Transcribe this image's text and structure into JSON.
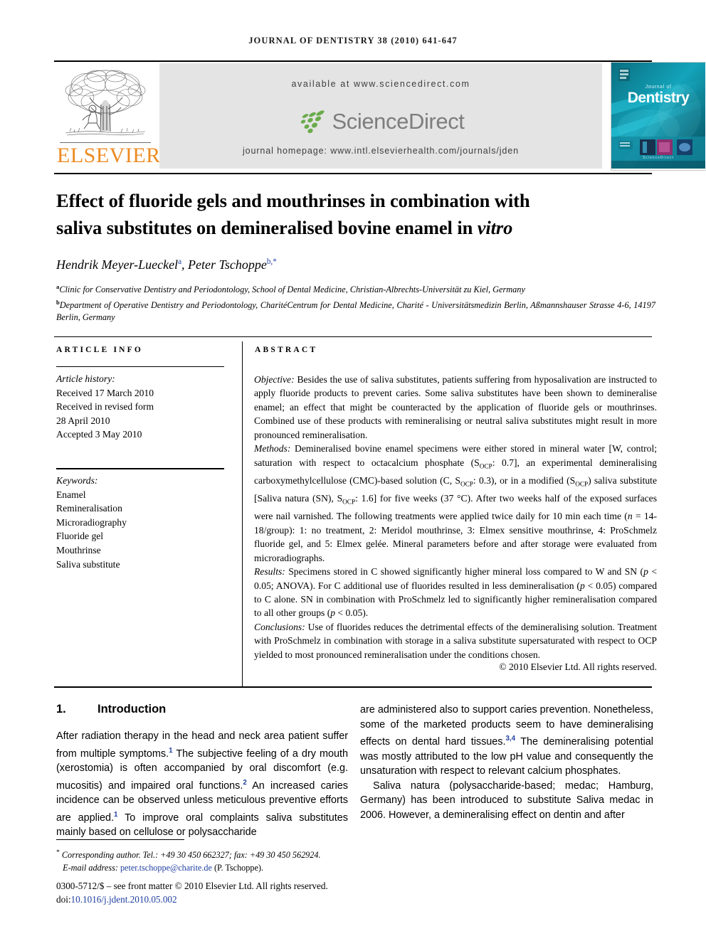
{
  "running_head": "JOURNAL OF DENTISTRY 38 (2010) 641-647",
  "masthead": {
    "publisher_wordmark": "ELSEVIER",
    "available_at": "available at www.sciencedirect.com",
    "sciencedirect_word": "ScienceDirect",
    "journal_homepage": "journal homepage: www.intl.elsevierhealth.com/journals/jden",
    "cover_title_small": "Journal of",
    "cover_title_main": "Dentistry",
    "colors": {
      "elsevier_orange": "#ec8b22",
      "sciencedirect_green": "#6aab4a",
      "sciencedirect_grey": "#7d7d7d",
      "panel_grey": "#e4e4e4",
      "cover_teal": "#0e8a9c"
    }
  },
  "article": {
    "title_line1": "Effect of fluoride gels and mouthrinses in combination with",
    "title_line2_pre": "saliva substitutes on demineralised bovine enamel in ",
    "title_line2_italic": "vitro",
    "authors": [
      {
        "name": "Hendrik Meyer-Lueckel",
        "mark": "a"
      },
      {
        "name": "Peter Tschoppe",
        "mark": "b,*"
      }
    ],
    "affiliations": [
      {
        "mark": "a",
        "text": "Clinic for Conservative Dentistry and Periodontology, School of Dental Medicine, Christian-Albrechts-Universität zu Kiel, Germany"
      },
      {
        "mark": "b",
        "text": "Department of Operative Dentistry and Periodontology, CharitéCentrum for Dental Medicine, Charité - Universitätsmedizin Berlin, Aßmannshauser Strasse 4-6, 14197 Berlin, Germany"
      }
    ]
  },
  "info_column": {
    "heading": "ARTICLE INFO",
    "history_label": "Article history:",
    "history_lines": [
      "Received 17 March 2010",
      "Received in revised form",
      "28 April 2010",
      "Accepted 3 May 2010"
    ],
    "keywords_label": "Keywords:",
    "keywords": [
      "Enamel",
      "Remineralisation",
      "Microradiography",
      "Fluoride gel",
      "Mouthrinse",
      "Saliva substitute"
    ]
  },
  "abstract": {
    "heading": "ABSTRACT",
    "objective_label": "Objective:",
    "objective_text": " Besides the use of saliva substitutes, patients suffering from hyposalivation are instructed to apply fluoride products to prevent caries. Some saliva substitutes have been shown to demineralise enamel; an effect that might be counteracted by the application of fluoride gels or mouthrinses. Combined use of these products with remineralising or neutral saliva substitutes might result in more pronounced remineralisation.",
    "methods_label": "Methods:",
    "methods_text_1": " Demineralised bovine enamel specimens were either stored in mineral water [W, control; saturation with respect to octacalcium phosphate (S",
    "methods_sub_1": "OCP",
    "methods_text_2": ": 0.7], an experimental demineralising carboxymethylcellulose (CMC)-based solution (C, S",
    "methods_sub_2": "OCP",
    "methods_text_3": ": 0.3), or in a modified (S",
    "methods_sub_3": "OCP",
    "methods_text_4": ") saliva substitute [Saliva natura (SN), S",
    "methods_sub_4": "OCP",
    "methods_text_5": ": 1.6] for five weeks (37 °C). After two weeks half of the exposed surfaces were nail varnished. The following treatments were applied twice daily for 10 min each time (",
    "methods_italic_n": "n",
    "methods_text_6": " = 14-18/group): 1: no treatment, 2: Meridol mouthrinse, 3: Elmex sensitive mouthrinse, 4: ProSchmelz fluoride gel, and 5: Elmex gelée. Mineral parameters before and after storage were evaluated from microradiographs.",
    "results_label": "Results:",
    "results_text_1": " Specimens stored in C showed significantly higher mineral loss compared to W and SN (",
    "results_p1": "p",
    "results_text_2": " < 0.05; ANOVA). For C additional use of fluorides resulted in less demineralisation (",
    "results_p2": "p",
    "results_text_3": " < 0.05) compared to C alone. SN in combination with ProSchmelz led to significantly higher remineralisation compared to all other groups (",
    "results_p3": "p",
    "results_text_4": " < 0.05).",
    "conclusions_label": "Conclusions:",
    "conclusions_text": " Use of fluorides reduces the detrimental effects of the demineralising solution. Treatment with ProSchmelz in combination with storage in a saliva substitute supersaturated with respect to OCP yielded to most pronounced remineralisation under the conditions chosen.",
    "copyright": "© 2010 Elsevier Ltd. All rights reserved."
  },
  "introduction": {
    "number": "1.",
    "heading": "Introduction",
    "left_p1_a": "After radiation therapy in the head and neck area patient suffer from multiple symptoms.",
    "left_p1_ref1": "1",
    "left_p1_b": " The subjective feeling of a dry mouth (xerostomia) is often accompanied by oral discomfort (e.g. mucositis) and impaired oral functions.",
    "left_p1_ref2": "2",
    "left_p1_c": " An increased caries incidence can be observed unless meticulous preventive efforts are applied.",
    "left_p1_ref3": "1",
    "left_p1_d": " To improve oral complaints saliva substitutes mainly based on cellulose or polysaccharide",
    "right_p1_a": "are administered also to support caries prevention. Nonetheless, some of the marketed products seem to have demineralising effects on dental hard tissues.",
    "right_p1_ref": "3,4",
    "right_p1_b": " The demineralising potential was mostly attributed to the low pH value and consequently the unsaturation with respect to relevant calcium phosphates.",
    "right_p2": "Saliva natura (polysaccharide-based; medac; Hamburg, Germany) has been introduced to substitute Saliva medac in 2006. However, a demineralising effect on dentin and after"
  },
  "footer": {
    "corresponding_star": "*",
    "corresponding_label": "Corresponding author.",
    "corresponding_contact": " Tel.: +49 30 450 662327; fax: +49 30 450 562924.",
    "email_label": "E-mail address:",
    "email": "peter.tschoppe@charite.de",
    "email_suffix": " (P. Tschoppe).",
    "frontmatter": "0300-5712/$ – see front matter © 2010 Elsevier Ltd. All rights reserved.",
    "doi_label": "doi:",
    "doi": "10.1016/j.jdent.2010.05.002"
  }
}
